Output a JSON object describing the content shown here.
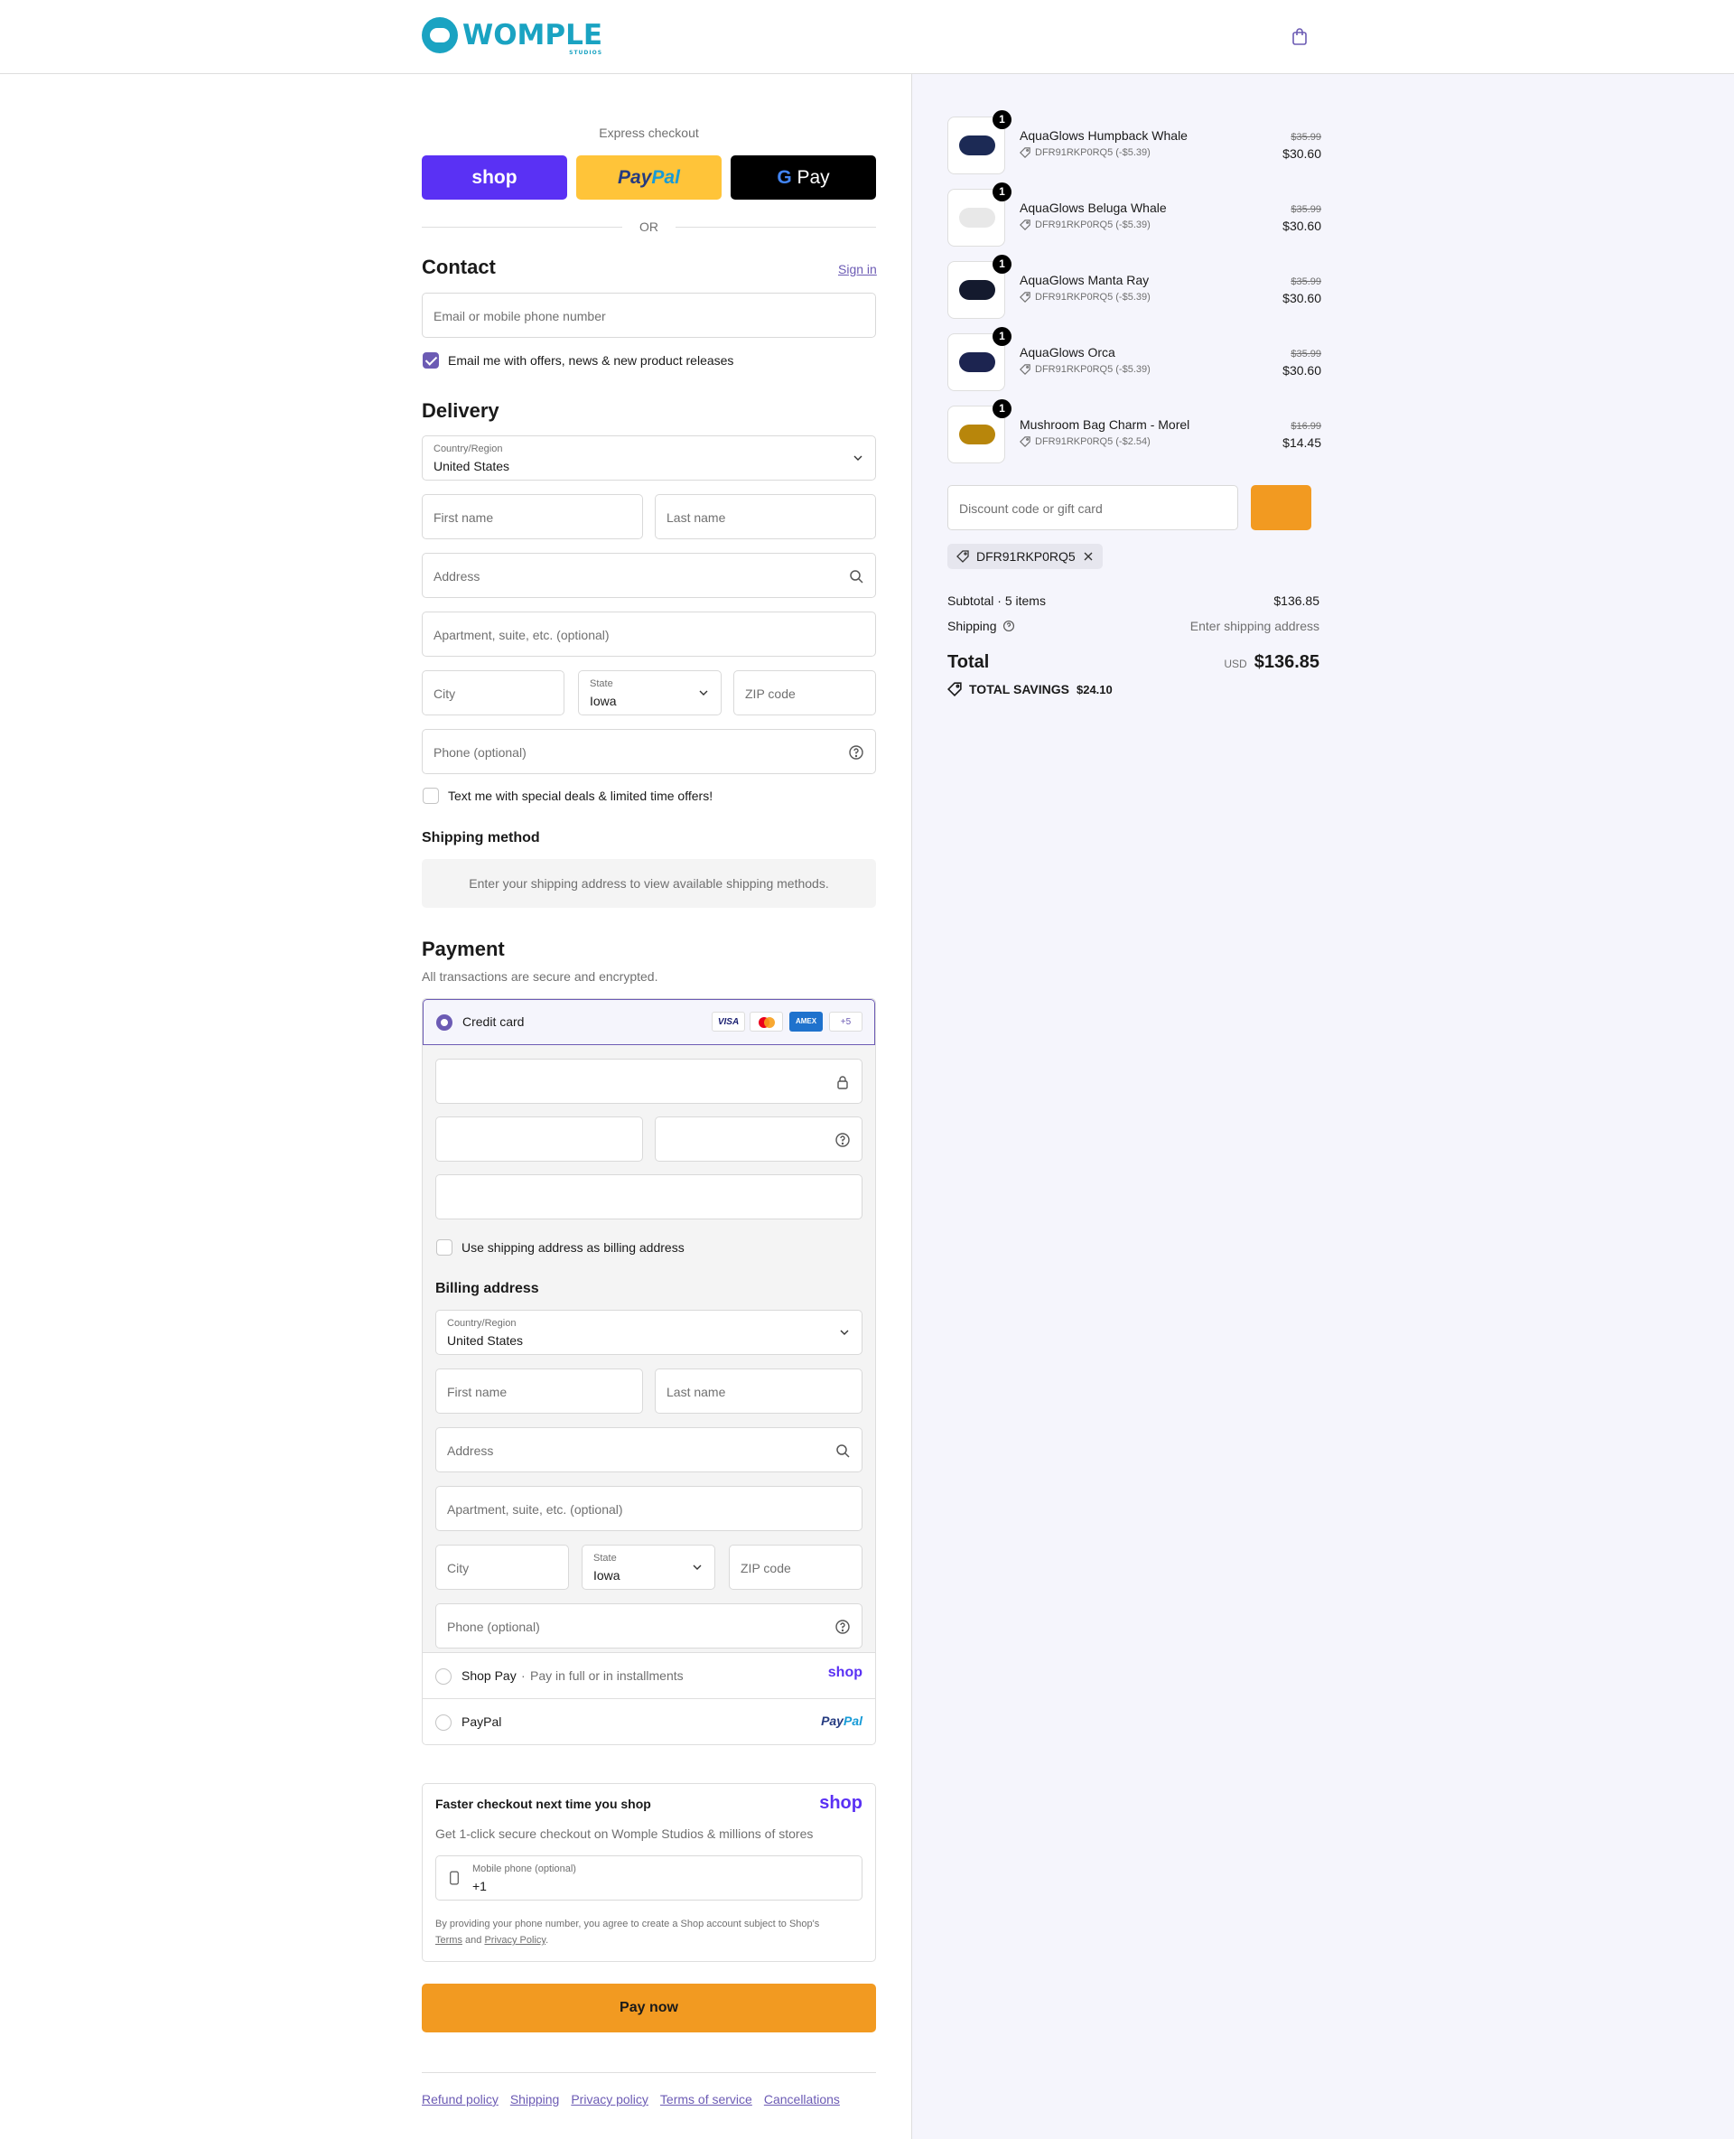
{
  "header": {
    "brand": "WOMPLE",
    "brand_sub": "STUDIOS",
    "cart_icon": "shopping-bag-icon"
  },
  "express": {
    "title": "Express checkout",
    "shop_label": "shop",
    "paypal_label_a": "Pay",
    "paypal_label_b": "Pal",
    "gpay_label": "Pay",
    "or": "OR"
  },
  "contact": {
    "title": "Contact",
    "sign_in": "Sign in",
    "email_placeholder": "Email or mobile phone number",
    "email_opt_in": "Email me with offers, news & new product releases",
    "email_opt_in_checked": true
  },
  "delivery": {
    "title": "Delivery",
    "country_label": "Country/Region",
    "country_value": "United States",
    "first_name": "First name",
    "last_name": "Last name",
    "address": "Address",
    "apartment": "Apartment, suite, etc. (optional)",
    "city": "City",
    "state_label": "State",
    "state_value": "Iowa",
    "zip": "ZIP code",
    "phone": "Phone (optional)",
    "sms_opt_in": "Text me with special deals & limited time offers!"
  },
  "shipping_method": {
    "title": "Shipping method",
    "notice": "Enter your shipping address to view available shipping methods."
  },
  "payment": {
    "title": "Payment",
    "subtitle": "All transactions are secure and encrypted.",
    "credit_card": "Credit card",
    "cards": [
      "VISA",
      "MC",
      "AMEX",
      "+5"
    ],
    "use_shipping": "Use shipping address as billing address",
    "billing_title": "Billing address",
    "billing": {
      "country_label": "Country/Region",
      "country_value": "United States",
      "first_name": "First name",
      "last_name": "Last name",
      "address": "Address",
      "apartment": "Apartment, suite, etc. (optional)",
      "city": "City",
      "state_label": "State",
      "state_value": "Iowa",
      "zip": "ZIP code",
      "phone": "Phone (optional)"
    },
    "shop_pay": "Shop Pay",
    "shop_pay_sep": "·",
    "shop_pay_desc": "Pay in full or in installments",
    "shop_logo": "shop",
    "paypal": "PayPal",
    "paypal_logo_a": "Pay",
    "paypal_logo_b": "Pal"
  },
  "faster": {
    "title": "Faster checkout next time you shop",
    "shop_logo": "shop",
    "desc": "Get 1-click secure checkout on Womple Studios & millions of stores",
    "phone_label": "Mobile phone (optional)",
    "phone_value": "+1",
    "legal_1": "By providing your phone number, you agree to create a Shop account subject to Shop's",
    "terms": "Terms",
    "and": "and",
    "privacy": "Privacy Policy",
    "dot": "."
  },
  "pay_now": "Pay now",
  "footer_links": [
    "Refund policy",
    "Shipping",
    "Privacy policy",
    "Terms of service",
    "Cancellations"
  ],
  "cart": {
    "items": [
      {
        "name": "AquaGlows Humpback Whale",
        "code": "DFR91RKP0RQ5 (-$5.39)",
        "old": "$35.99",
        "price": "$30.60",
        "qty": "1",
        "color": "#1c2a55"
      },
      {
        "name": "AquaGlows Beluga Whale",
        "code": "DFR91RKP0RQ5 (-$5.39)",
        "old": "$35.99",
        "price": "$30.60",
        "qty": "1",
        "color": "#e8e8e8"
      },
      {
        "name": "AquaGlows Manta Ray",
        "code": "DFR91RKP0RQ5 (-$5.39)",
        "old": "$35.99",
        "price": "$30.60",
        "qty": "1",
        "color": "#141a2e"
      },
      {
        "name": "AquaGlows Orca",
        "code": "DFR91RKP0RQ5 (-$5.39)",
        "old": "$35.99",
        "price": "$30.60",
        "qty": "1",
        "color": "#1c2450"
      },
      {
        "name": "Mushroom Bag Charm - Morel",
        "code": "DFR91RKP0RQ5 (-$2.54)",
        "old": "$16.99",
        "price": "$14.45",
        "qty": "1",
        "color": "#b8860b"
      }
    ],
    "discount_placeholder": "Discount code or gift card",
    "applied_code": "DFR91RKP0RQ5",
    "subtotal_label": "Subtotal · 5 items",
    "subtotal_value": "$136.85",
    "shipping_label": "Shipping",
    "shipping_value": "Enter shipping address",
    "total_label": "Total",
    "total_currency": "USD",
    "total_value": "$136.85",
    "savings_label": "TOTAL SAVINGS",
    "savings_value": "$24.10"
  },
  "colors": {
    "accent": "#6c5bb4",
    "pay_button": "#f29a21",
    "shop_purple": "#5a31f4",
    "paypal_yellow": "#ffc439"
  }
}
